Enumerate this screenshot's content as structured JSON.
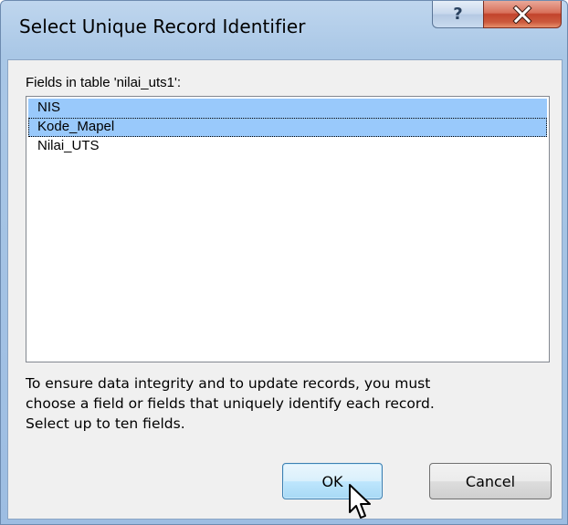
{
  "window": {
    "title": "Select Unique Record Identifier",
    "help_glyph": "?",
    "close_icon": "close-icon",
    "accent_color": "#99c9fb"
  },
  "dialog": {
    "fields_label": "Fields in table 'nilai_uts1':",
    "fields": [
      {
        "label": "NIS",
        "selected": true,
        "focused": false
      },
      {
        "label": "Kode_Mapel",
        "selected": true,
        "focused": true
      },
      {
        "label": "Nilai_UTS",
        "selected": false,
        "focused": false
      }
    ],
    "hint": "To ensure data integrity and to update records, you must\nchoose a field or fields that uniquely identify each record.\nSelect up to ten fields.",
    "ok_label": "OK",
    "cancel_label": "Cancel"
  }
}
